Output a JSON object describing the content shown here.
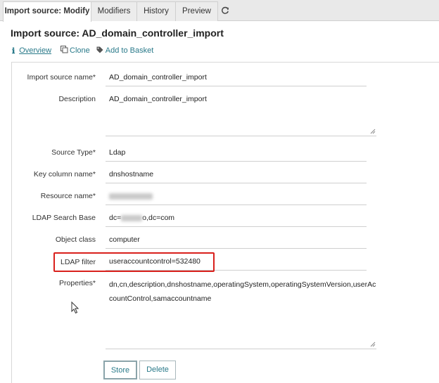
{
  "tabs": [
    {
      "label": "Import source: Modify",
      "active": true
    },
    {
      "label": "Modifiers",
      "active": false
    },
    {
      "label": "History",
      "active": false
    },
    {
      "label": "Preview",
      "active": false
    }
  ],
  "refresh_icon": "refresh-icon",
  "page_title": "Import source: AD_domain_controller_import",
  "actions": {
    "overview": "Overview",
    "clone": "Clone",
    "add_to_basket": "Add to Basket"
  },
  "fields": {
    "import_source_name": {
      "label": "Import source name*",
      "value": "AD_domain_controller_import"
    },
    "description": {
      "label": "Description",
      "value": "AD_domain_controller_import"
    },
    "source_type": {
      "label": "Source Type*",
      "value": "Ldap"
    },
    "key_column_name": {
      "label": "Key column name*",
      "value": "dnshostname"
    },
    "resource_name": {
      "label": "Resource name*"
    },
    "ldap_search_base": {
      "label": "LDAP Search Base",
      "value_prefix": "dc=",
      "value_suffix": "o,dc=com"
    },
    "object_class": {
      "label": "Object class",
      "value": "computer"
    },
    "ldap_filter": {
      "label": "LDAP filter",
      "value": "useraccountcontrol=532480"
    },
    "properties": {
      "label": "Properties*",
      "line1": "dn,cn,description,dnshostname,operatingSystem,operatingSystemVersion,userAc",
      "line2": "countControl,samaccountname"
    }
  },
  "buttons": {
    "store": "Store",
    "delete": "Delete"
  },
  "colors": {
    "link": "#2a7a8a",
    "highlight": "#d9201c",
    "tabbar": "#e9e9e9"
  }
}
